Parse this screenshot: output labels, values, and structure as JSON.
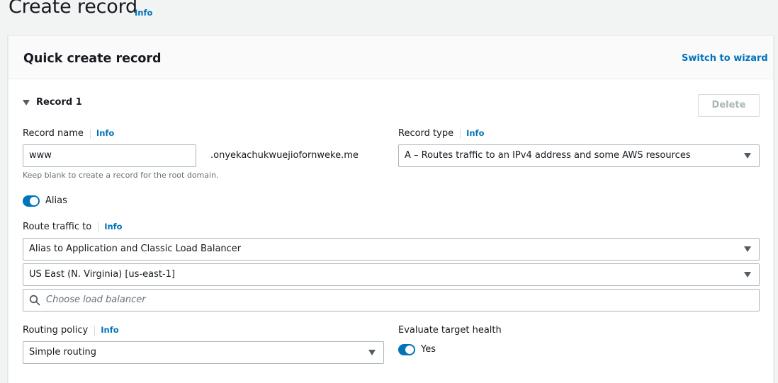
{
  "page": {
    "title": "Create record",
    "info": "Info"
  },
  "panel": {
    "title": "Quick create record",
    "switch_wizard": "Switch to wizard"
  },
  "record": {
    "heading": "Record 1",
    "delete_label": "Delete",
    "record_name": {
      "label": "Record name",
      "info": "Info",
      "value": "www",
      "domain_suffix": ".onyekachukwuejiofornweke.me",
      "hint": "Keep blank to create a record for the root domain."
    },
    "record_type": {
      "label": "Record type",
      "info": "Info",
      "value": "A – Routes traffic to an IPv4 address and some AWS resources"
    },
    "alias": {
      "label": "Alias",
      "enabled": true
    },
    "route_traffic": {
      "label": "Route traffic to",
      "info": "Info",
      "endpoint": "Alias to Application and Classic Load Balancer",
      "region": "US East (N. Virginia) [us-east-1]",
      "search_placeholder": "Choose load balancer"
    },
    "routing_policy": {
      "label": "Routing policy",
      "info": "Info",
      "value": "Simple routing"
    },
    "evaluate_health": {
      "label": "Evaluate target health",
      "toggle_label": "Yes",
      "enabled": true
    }
  },
  "colors": {
    "link": "#0073bb",
    "toggle_on": "#0073bb",
    "border": "#aab7b8"
  },
  "icons": {
    "expand": "caret-down-icon",
    "search": "search-icon",
    "dropdown": "chevron-down-icon"
  }
}
